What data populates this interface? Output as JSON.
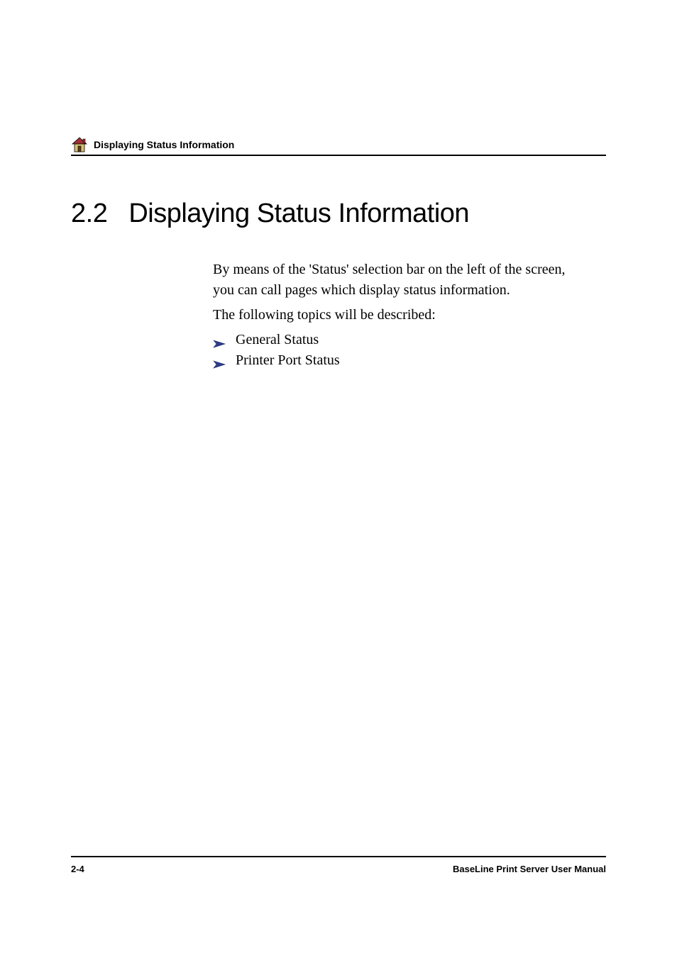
{
  "header": {
    "running_title": "Displaying Status Information"
  },
  "section": {
    "number": "2.2",
    "title": "Displaying Status Information"
  },
  "body": {
    "para1": "By means of the 'Status' selection bar on the left of the screen, you can call pages which display status information.",
    "para2": "The following topics will be described:",
    "bullets": {
      "0": "General Status",
      "1": "Printer Port Status"
    }
  },
  "footer": {
    "page": "2-4",
    "manual": "BaseLine Print Server User Manual"
  },
  "icons": {
    "header_icon": "home-icon",
    "bullet_arrow": "arrow-right-icon"
  },
  "colors": {
    "arrow_fill": "#2e3e8c",
    "arrow_stroke": "#1a2660",
    "icon_roof": "#a03030",
    "icon_wall": "#d8c070",
    "icon_outline": "#000000"
  }
}
